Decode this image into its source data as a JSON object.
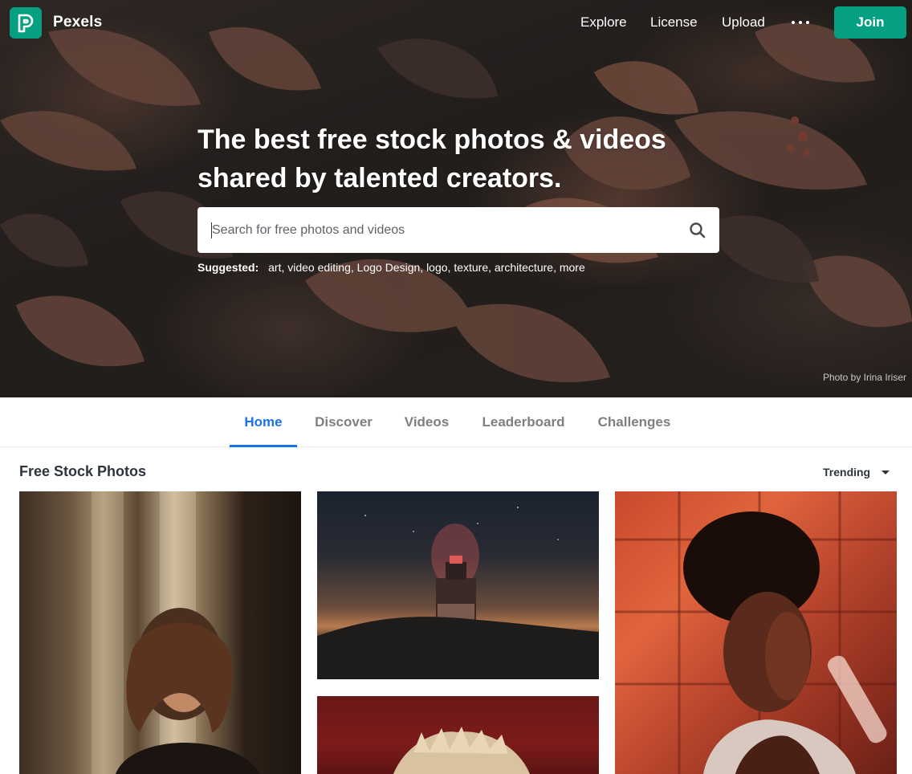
{
  "header": {
    "brand": "Pexels",
    "nav": {
      "explore": "Explore",
      "license": "License",
      "upload": "Upload"
    },
    "more_icon": "more-dots-icon",
    "join_label": "Join",
    "logo_icon": "pexels-logo-icon"
  },
  "hero": {
    "title_line1": "The best free stock photos & videos",
    "title_line2": "shared by talented creators.",
    "search": {
      "placeholder": "Search for free photos and videos",
      "value": "",
      "icon": "search-icon"
    },
    "suggested_label": "Suggested:",
    "suggested_tags": [
      "art",
      "video editing",
      "Logo Design",
      "logo",
      "texture",
      "architecture",
      "more"
    ],
    "credit": "Photo by Irina Iriser"
  },
  "tabs": {
    "items": [
      {
        "label": "Home",
        "active": true
      },
      {
        "label": "Discover",
        "active": false
      },
      {
        "label": "Videos",
        "active": false
      },
      {
        "label": "Leaderboard",
        "active": false
      },
      {
        "label": "Challenges",
        "active": false
      }
    ]
  },
  "section": {
    "title": "Free Stock Photos",
    "sort_label": "Trending",
    "sort_icon": "caret-down-icon"
  },
  "colors": {
    "brand_green": "#05a081",
    "tab_active": "#1a73e8",
    "tab_inactive": "#7f7f7f",
    "text": "#2c343e"
  }
}
